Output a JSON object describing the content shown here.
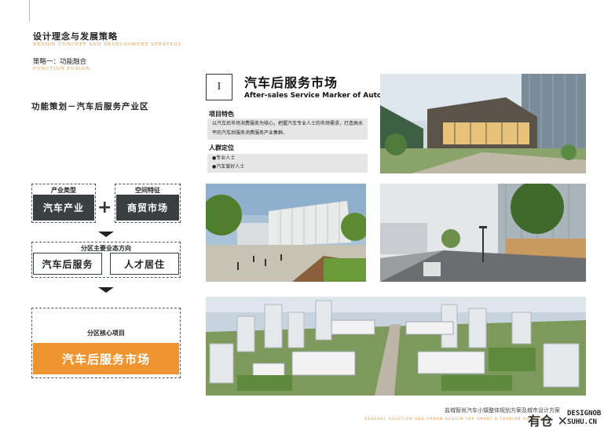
{
  "header": {
    "title_cn": "设计理念与发展策略",
    "title_en": "DESIGN CONCEPT AND DEVELOPMENT STRATEGY",
    "strategy_cn": "策略一：功能融合",
    "strategy_en": "FUNCTION FUSION"
  },
  "left": {
    "heading": "功能策划－汽车后服务产业区",
    "industry_label": "产业类型",
    "industry_value": "汽车产业",
    "space_label": "空间特征",
    "space_value": "商贸市场",
    "plus": "+",
    "direction_label": "分区主要业态方向",
    "direction_items": [
      "汽车后服务",
      "人才居住"
    ],
    "core_label": "分区核心项目",
    "core_value": "汽车后服务市场"
  },
  "market": {
    "numeral": "I",
    "title_cn": "汽车后服务市场",
    "title_en": "After-sales Service Marker of Auto",
    "feature_heading": "项目特色",
    "feature_text": "以汽车后市场消费服务为核心，把握汽车专业人士的市场需求，打造高水平的汽车后服务消费服务产业集群。",
    "people_heading": "人群定位",
    "people_items": [
      "●专业人士",
      "●汽车爱好人士"
    ]
  },
  "footer": {
    "cn": "盐城智尚汽车小镇整体规划方案及城市设计方案",
    "en": "GENERAL SOLUTION AND URBAN DESIGN FOR SMART & FASHION AUTO TOWN",
    "watermark_cn": "有仓 ✕",
    "watermark_en_1": "DESIGNOB",
    "watermark_en_2": "SUHU.CN"
  }
}
